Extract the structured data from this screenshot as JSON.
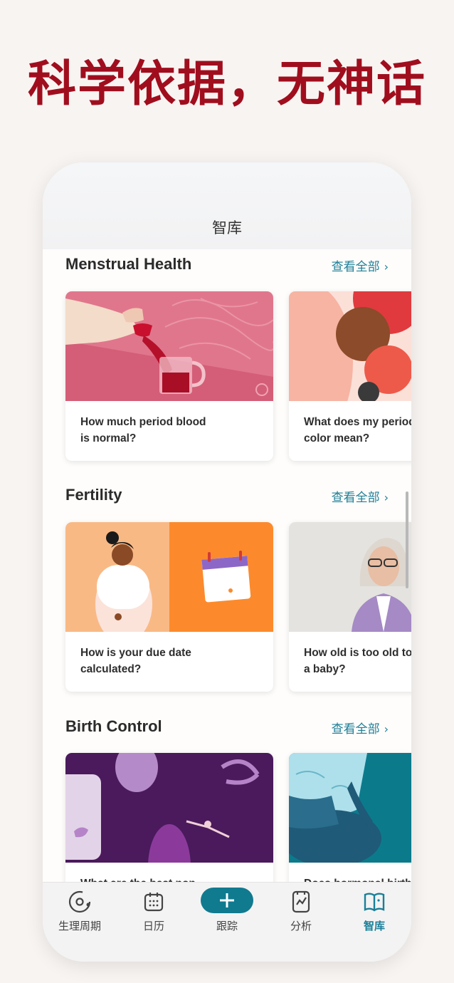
{
  "headline": "科学依据，无神话",
  "screen": {
    "title": "智库"
  },
  "sections": [
    {
      "title": "Menstrual Health",
      "see_all": "查看全部",
      "cards": [
        {
          "text": "How much period blood\nis normal?"
        },
        {
          "text": "What does my period\ncolor mean?"
        }
      ]
    },
    {
      "title": "Fertility",
      "see_all": "查看全部",
      "cards": [
        {
          "text": "How is your due date\ncalculated?"
        },
        {
          "text": "How old is too old to have\na baby?"
        }
      ]
    },
    {
      "title": "Birth Control",
      "see_all": "查看全部",
      "cards": [
        {
          "text": "What are the best non-"
        },
        {
          "text": "Does hormonal birth"
        }
      ]
    }
  ],
  "tabs": [
    {
      "label": "生理周期",
      "icon": "cycle-icon",
      "active": false
    },
    {
      "label": "日历",
      "icon": "calendar-icon",
      "active": false
    },
    {
      "label": "跟踪",
      "icon": "plus-icon",
      "active": false
    },
    {
      "label": "分析",
      "icon": "analysis-icon",
      "active": false
    },
    {
      "label": "智库",
      "icon": "library-book-icon",
      "active": true
    }
  ],
  "colors": {
    "headline": "#a00e1e",
    "accent": "#1f7f98",
    "add_button": "#107a8f",
    "page_background": "#f8f4f2"
  }
}
